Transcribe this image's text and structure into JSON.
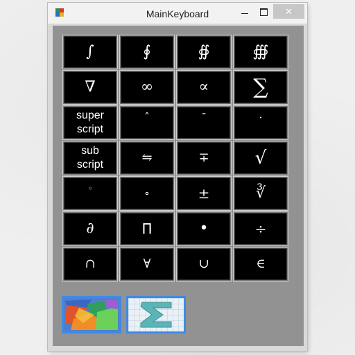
{
  "window": {
    "title": "MainKeyboard",
    "minimize_icon": "minimize-icon",
    "maximize_icon": "maximize-icon",
    "close_icon": "close-icon"
  },
  "keys": [
    [
      "∫",
      "∮",
      "∯",
      "∰"
    ],
    [
      "∇",
      "∞",
      "∝",
      "∑"
    ],
    [
      "super\nscript",
      "ˆ",
      "¯",
      "·"
    ],
    [
      "sub\nscript",
      "⇋",
      "∓",
      "√"
    ],
    [
      "◦",
      "∘",
      "±",
      "∛"
    ],
    [
      "∂",
      "Π",
      "•",
      "÷"
    ],
    [
      "∩",
      "∀",
      "∪",
      "∈"
    ]
  ],
  "bottom_buttons": [
    {
      "icon": "shapes-icon"
    },
    {
      "icon": "sigma-icon"
    }
  ],
  "colors": {
    "key_background": "#000000",
    "key_text": "#ffffff",
    "panel": "#929292",
    "button_border": "#3d8be6"
  }
}
